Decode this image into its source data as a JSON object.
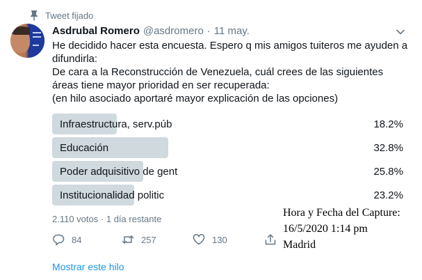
{
  "pinned_label": "Tweet fijado",
  "author": {
    "name": "Asdrubal Romero",
    "handle": "@asdromero",
    "separator": "·",
    "date": "11 may."
  },
  "tweet": {
    "lines": [
      "He decidido hacer esta encuesta. Espero q mis amigos tuiteros me ayuden a difundirla:",
      "De cara a la Reconstrucción de Venezuela, cuál crees de las siguientes áreas tiene mayor prioridad en ser recuperada:",
      "(en hilo asociado aportaré mayor explicación de las opciones)"
    ]
  },
  "poll": {
    "options": [
      {
        "label": "Infraestructura, serv.púb",
        "percent_text": "18.2%",
        "percent": 18.2
      },
      {
        "label": "Educación",
        "percent_text": "32.8%",
        "percent": 32.8
      },
      {
        "label": "Poder adquisitivo de gent",
        "percent_text": "25.8%",
        "percent": 25.8
      },
      {
        "label": "Institucionalidad politic",
        "percent_text": "23.2%",
        "percent": 23.2
      }
    ],
    "votes": "2.110 votos",
    "separator": "·",
    "remaining": "1 día restante"
  },
  "actions": {
    "replies": "84",
    "retweets": "257",
    "likes": "130"
  },
  "show_thread": "Mostrar este hilo",
  "capture_note": {
    "line1": "Hora y Fecha del Capture:",
    "line2": "16/5/2020 1:14 pm",
    "line3": "Madrid"
  },
  "colors": {
    "secondary_text": "#657786",
    "poll_bar": "#cfd9de",
    "link": "#1b95e0"
  }
}
